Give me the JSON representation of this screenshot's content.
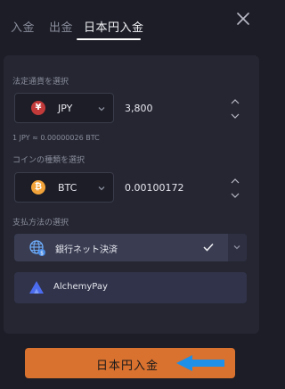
{
  "tabs": [
    {
      "label": "入金",
      "active": false
    },
    {
      "label": "出金",
      "active": false
    },
    {
      "label": "日本円入金",
      "active": true
    }
  ],
  "fiat": {
    "section_label": "法定通貨を選択",
    "currency_symbol": "¥",
    "currency": "JPY",
    "amount": "3,800"
  },
  "rate_text": "1 JPY ≈ 0.00000026 BTC",
  "coin": {
    "section_label": "コインの種類を選択",
    "currency_symbol": "₿",
    "currency": "BTC",
    "amount": "0.00100172"
  },
  "payment": {
    "section_label": "支払方法の選択",
    "methods": [
      {
        "label": "銀行ネット決済",
        "selected": true,
        "icon": "globe-icon"
      },
      {
        "label": "AlchemyPay",
        "selected": false,
        "icon": "alchemypay-logo"
      }
    ]
  },
  "cta": {
    "label": "日本円入金"
  },
  "colors": {
    "background": "#1c1d26",
    "panel": "#252632",
    "accent": "#d9712f",
    "arrow": "#1e90e8",
    "jpy_badge": "#c23a3a",
    "btc_badge": "#f2a33a"
  }
}
